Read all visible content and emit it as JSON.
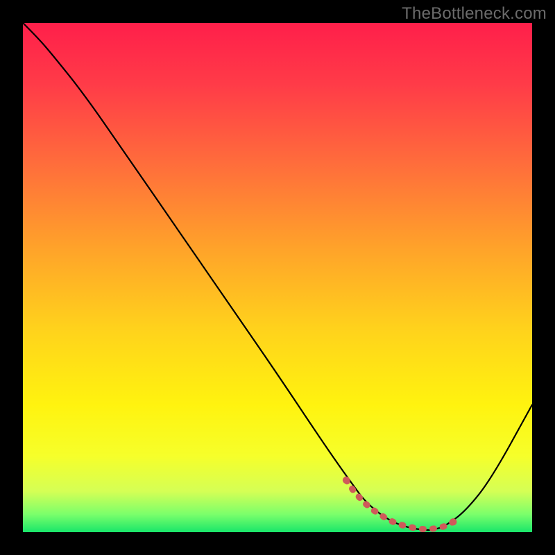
{
  "watermark": "TheBottleneck.com",
  "chart_data": {
    "type": "line",
    "title": "",
    "xlabel": "",
    "ylabel": "",
    "xlim": [
      0,
      100
    ],
    "ylim": [
      0,
      100
    ],
    "background_gradient": {
      "stops": [
        {
          "offset": 0.0,
          "color": "#ff1f4a"
        },
        {
          "offset": 0.12,
          "color": "#ff3b48"
        },
        {
          "offset": 0.28,
          "color": "#ff6e3b"
        },
        {
          "offset": 0.45,
          "color": "#ffa529"
        },
        {
          "offset": 0.6,
          "color": "#ffd21c"
        },
        {
          "offset": 0.75,
          "color": "#fff30f"
        },
        {
          "offset": 0.85,
          "color": "#f6ff2a"
        },
        {
          "offset": 0.92,
          "color": "#d5ff55"
        },
        {
          "offset": 0.965,
          "color": "#7bff6b"
        },
        {
          "offset": 1.0,
          "color": "#19e66a"
        }
      ]
    },
    "series": [
      {
        "name": "bottleneck-curve",
        "color": "#000000",
        "x": [
          0,
          3,
          6,
          12,
          20,
          30,
          40,
          50,
          58,
          62,
          65,
          67,
          70,
          73,
          76,
          79,
          80.5,
          83,
          87,
          92,
          100
        ],
        "y": [
          100,
          97,
          93.5,
          86,
          74.5,
          60,
          45.5,
          31,
          19,
          13.2,
          9,
          6.3,
          3.6,
          1.8,
          0.8,
          0.4,
          0.4,
          1.2,
          4.2,
          10.5,
          25
        ]
      }
    ],
    "markers": {
      "name": "optimum-region",
      "color": "#cf5a5a",
      "style": "dashed-dots",
      "x": [
        63.5,
        65,
        67,
        69,
        71,
        72.5,
        74,
        75.5,
        77,
        78.5,
        80,
        81.5,
        83,
        84.5
      ],
      "y": [
        10.2,
        8.0,
        5.8,
        4.2,
        2.9,
        2.1,
        1.5,
        1.1,
        0.8,
        0.6,
        0.6,
        0.8,
        1.2,
        2.0
      ]
    }
  }
}
